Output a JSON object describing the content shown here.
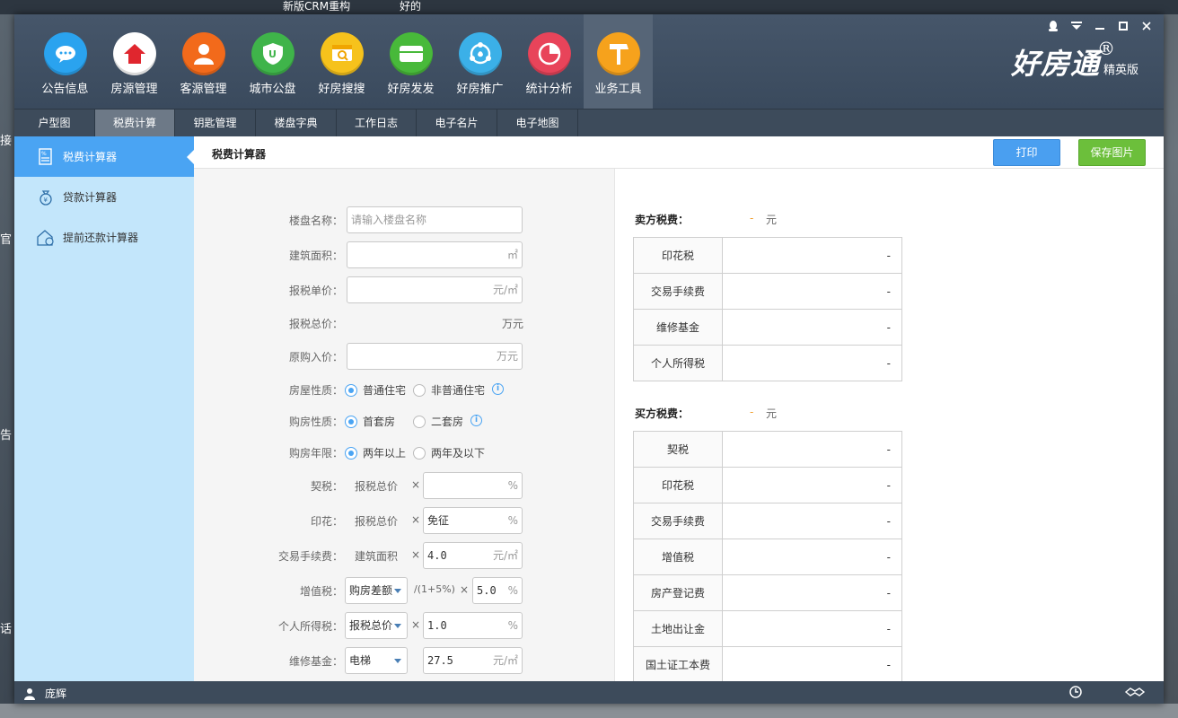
{
  "desktop": {
    "task1": "新版CRM重构",
    "task2": "好的",
    "left_chars": [
      "接",
      "官",
      "告",
      "话"
    ]
  },
  "window": {
    "brand_name": "好房通",
    "brand_reg": "®",
    "brand_edition": "精英版"
  },
  "nav": {
    "items": [
      {
        "label": "公告信息",
        "icon": "chat-bubble-icon",
        "color": "#2aa3ef"
      },
      {
        "label": "房源管理",
        "icon": "house-icon",
        "color": "#ffffff"
      },
      {
        "label": "客源管理",
        "icon": "person-icon",
        "color": "#f26a1b"
      },
      {
        "label": "城市公盘",
        "icon": "shield-icon",
        "color": "#3fb44a"
      },
      {
        "label": "好房搜搜",
        "icon": "search-card-icon",
        "color": "#f6c21c"
      },
      {
        "label": "好房发发",
        "icon": "mail-icon",
        "color": "#48b93a"
      },
      {
        "label": "好房推广",
        "icon": "share-icon",
        "color": "#3bb0e8"
      },
      {
        "label": "统计分析",
        "icon": "pie-chart-icon",
        "color": "#e8445a"
      },
      {
        "label": "业务工具",
        "icon": "hammer-icon",
        "color": "#f6a21c"
      }
    ]
  },
  "subnav": {
    "tabs": [
      "户型图",
      "税费计算",
      "钥匙管理",
      "楼盘字典",
      "工作日志",
      "电子名片",
      "电子地图"
    ]
  },
  "sidebar": {
    "items": [
      "税费计算器",
      "贷款计算器",
      "提前还款计算器"
    ]
  },
  "content": {
    "title": "税费计算器",
    "print": "打印",
    "save_image": "保存图片"
  },
  "form": {
    "estate_label": "楼盘名称：",
    "estate_placeholder": "请输入楼盘名称",
    "area_label": "建筑面积：",
    "area_unit": "㎡",
    "unit_price_label": "报税单价：",
    "unit_price_unit": "元/㎡",
    "total_label": "报税总价：",
    "total_unit": "万元",
    "orig_label": "原购入价：",
    "orig_unit": "万元",
    "house_type_label": "房屋性质：",
    "house_type_opt1": "普通住宅",
    "house_type_opt2": "非普通住宅",
    "buy_type_label": "购房性质：",
    "buy_type_opt1": "首套房",
    "buy_type_opt2": "二套房",
    "years_label": "购房年限：",
    "years_opt1": "两年以上",
    "years_opt2": "两年及以下",
    "deed_label": "契税：",
    "deed_base": "报税总价",
    "deed_unit": "%",
    "stamp_label": "印花：",
    "stamp_base": "报税总价",
    "stamp_value": "免征",
    "stamp_unit": "%",
    "fee_label": "交易手续费：",
    "fee_base": "建筑面积",
    "fee_value": "4.0",
    "fee_unit": "元/㎡",
    "vat_label": "增值税：",
    "vat_select": "购房差额",
    "vat_div": "/(1+5%)",
    "vat_value": "5.0",
    "vat_unit": "%",
    "pit_label": "个人所得税：",
    "pit_select": "报税总价",
    "pit_value": "1.0",
    "pit_unit": "%",
    "maint_label": "维修基金：",
    "maint_select": "电梯",
    "maint_value": "27.5",
    "maint_unit": "元/㎡",
    "times": "×"
  },
  "seller": {
    "title": "卖方税费：",
    "total": "-",
    "unit": "元",
    "rows": [
      {
        "k": "印花税",
        "v": "-"
      },
      {
        "k": "交易手续费",
        "v": "-"
      },
      {
        "k": "维修基金",
        "v": "-"
      },
      {
        "k": "个人所得税",
        "v": "-"
      }
    ]
  },
  "buyer": {
    "title": "买方税费：",
    "total": "-",
    "unit": "元",
    "rows": [
      {
        "k": "契税",
        "v": "-"
      },
      {
        "k": "印花税",
        "v": "-"
      },
      {
        "k": "交易手续费",
        "v": "-"
      },
      {
        "k": "增值税",
        "v": "-"
      },
      {
        "k": "房产登记费",
        "v": "-"
      },
      {
        "k": "土地出让金",
        "v": "-"
      },
      {
        "k": "国土证工本费",
        "v": "-"
      }
    ]
  },
  "status": {
    "user": "庞辉"
  }
}
